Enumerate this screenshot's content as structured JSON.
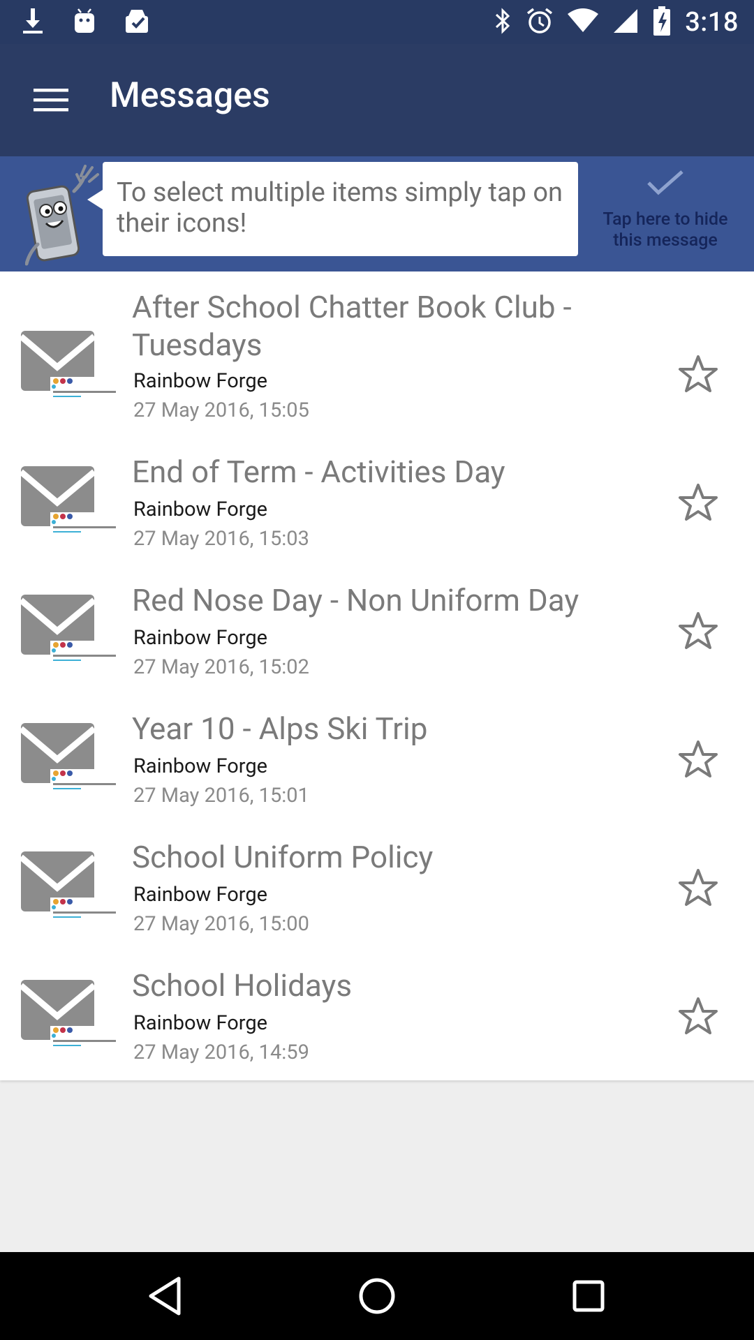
{
  "status_bar": {
    "left_icons": [
      "download-icon",
      "android-icon",
      "clipboard-check-icon"
    ],
    "right_icons": [
      "bluetooth-icon",
      "alarm-icon",
      "wifi-icon",
      "signal-icon",
      "battery-charging-icon"
    ],
    "time": "3:18"
  },
  "toolbar": {
    "menu_icon": "menu-icon",
    "title": "Messages"
  },
  "tip": {
    "text": "To select multiple items simply tap on their icons!",
    "hide_label": "Tap here to hide this message"
  },
  "messages": [
    {
      "title": "After School Chatter Book Club - Tuesdays",
      "sender": "Rainbow Forge",
      "date": "27 May 2016, 15:05"
    },
    {
      "title": "End of Term - Activities Day",
      "sender": "Rainbow Forge",
      "date": "27 May 2016, 15:03"
    },
    {
      "title": "Red Nose Day - Non Uniform Day",
      "sender": "Rainbow Forge",
      "date": "27 May 2016, 15:02"
    },
    {
      "title": "Year 10 - Alps Ski Trip",
      "sender": "Rainbow Forge",
      "date": "27 May 2016, 15:01"
    },
    {
      "title": "School Uniform Policy",
      "sender": "Rainbow Forge",
      "date": "27 May 2016, 15:00"
    },
    {
      "title": "School Holidays",
      "sender": "Rainbow Forge",
      "date": "27 May 2016, 14:59"
    }
  ],
  "nav_bar": [
    "back-icon",
    "home-icon",
    "recents-icon"
  ],
  "colors": {
    "status_bar": "#283a63",
    "toolbar": "#2b3c64",
    "tip_bar": "#3a5594",
    "background": "#eeeeee"
  }
}
